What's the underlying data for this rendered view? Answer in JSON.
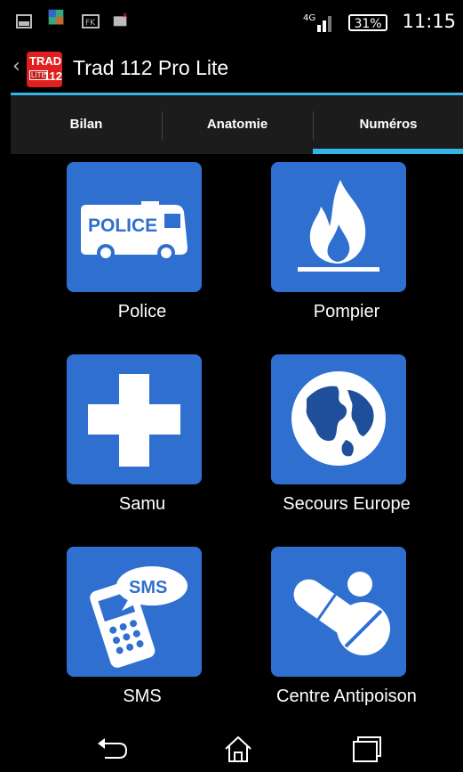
{
  "status_bar": {
    "network": "4G",
    "battery": "31%",
    "time": "11:15"
  },
  "action_bar": {
    "logo_trad": "TRAD",
    "logo_lite": "LITE",
    "logo_112": "112",
    "title": "Trad 112 Pro Lite"
  },
  "tabs": [
    {
      "label": "Bilan",
      "selected": false
    },
    {
      "label": "Anatomie",
      "selected": false
    },
    {
      "label": "Numéros",
      "selected": true
    }
  ],
  "tiles": [
    {
      "label": "Police",
      "icon": "police-van-icon",
      "badge": "POLICE"
    },
    {
      "label": "Pompier",
      "icon": "fire-icon"
    },
    {
      "label": "Samu",
      "icon": "medical-cross-icon"
    },
    {
      "label": "Secours Europe",
      "icon": "globe-icon"
    },
    {
      "label": "SMS",
      "icon": "sms-phone-icon",
      "badge": "SMS"
    },
    {
      "label": "Centre Antipoison",
      "icon": "pills-icon"
    }
  ],
  "colors": {
    "accent": "#33b5e5",
    "tile": "#2f6fd0",
    "logo": "#e02020"
  }
}
